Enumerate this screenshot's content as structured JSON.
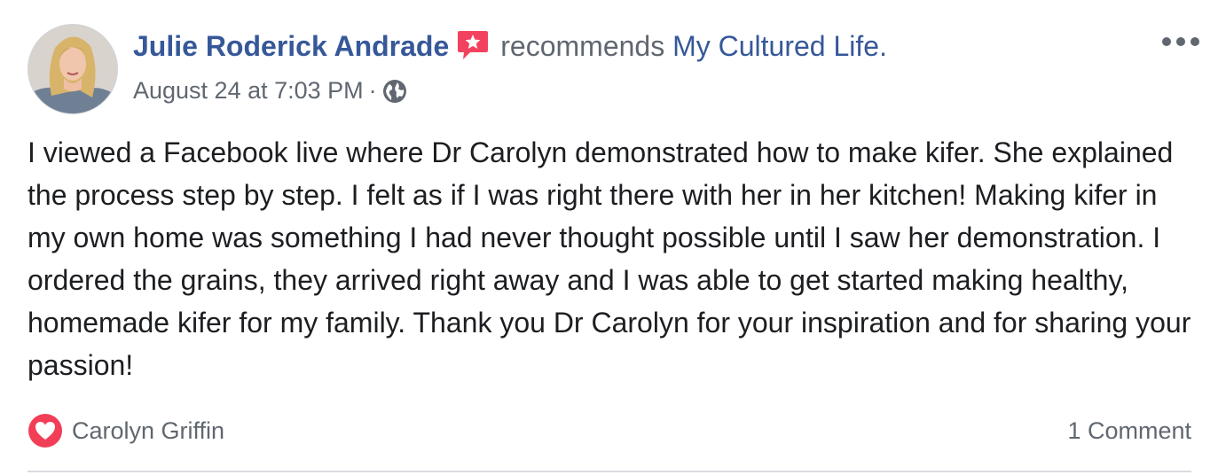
{
  "post": {
    "author": "Julie Roderick Andrade",
    "action": "recommends",
    "page": "My Cultured Life.",
    "timestamp": "August 24 at 7:03 PM",
    "separator": "·",
    "privacy_icon": "globe-icon",
    "recommend_icon": "recommendation-star-icon",
    "menu_icon": "more-options-icon",
    "body": "I viewed a Facebook live where Dr Carolyn demonstrated how to make kifer. She explained the process step by step. I felt as if I was right there with her in her kitchen! Making kifer in my own home was something I had never thought possible until I saw her demonstration. I ordered the grains, they arrived right away and I was able to get started making healthy, homemade kifer for my family. Thank you Dr Carolyn for your inspiration and for sharing your passion!"
  },
  "reactions": {
    "icon": "love-reaction-icon",
    "names": "Carolyn Griffin",
    "comments": "1 Comment"
  },
  "colors": {
    "link": "#365899",
    "secondary_text": "#606770",
    "love": "#f33e58",
    "recommend": "#f3425f"
  }
}
